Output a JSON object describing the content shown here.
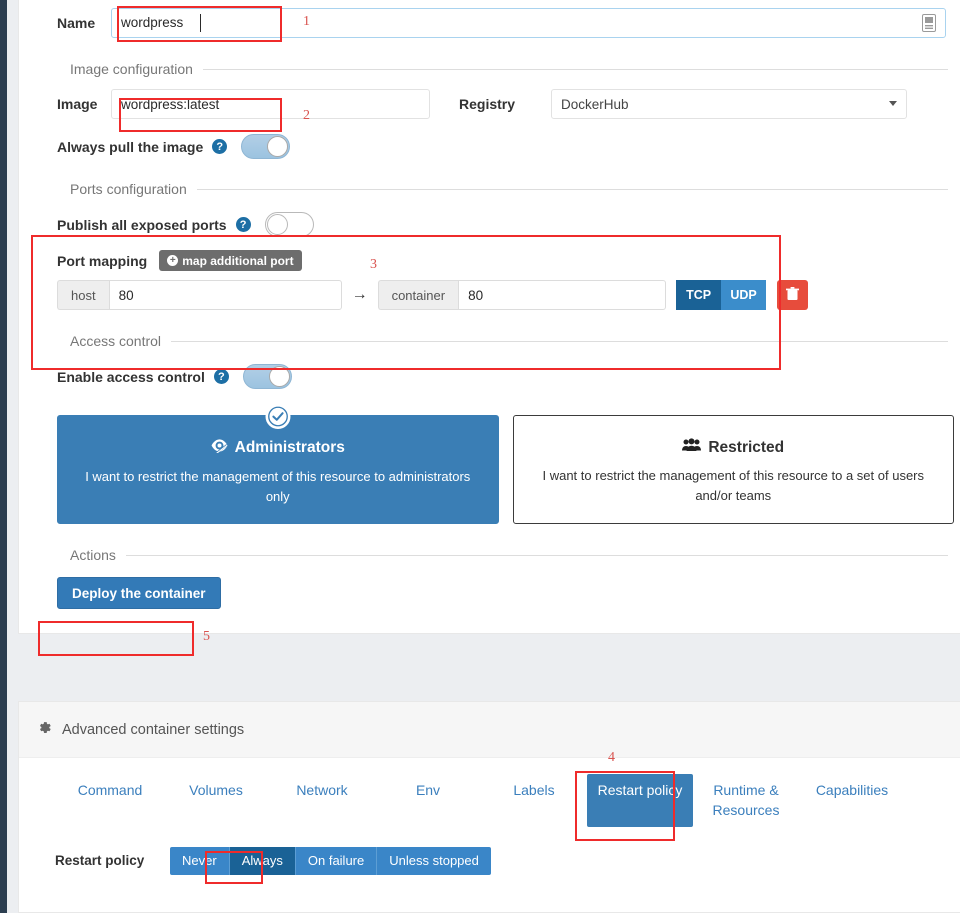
{
  "form": {
    "name": {
      "label": "Name",
      "value": "wordpress",
      "icon": "id-badge-icon"
    },
    "sections": {
      "image": "Image configuration",
      "ports": "Ports configuration",
      "access": "Access control",
      "actions": "Actions"
    },
    "image": {
      "label": "Image",
      "value": "wordpress:latest"
    },
    "registry": {
      "label": "Registry",
      "value": "DockerHub",
      "options": [
        "DockerHub"
      ]
    },
    "always_pull": {
      "label": "Always pull the image",
      "state": "on",
      "help": "?"
    },
    "publish_all": {
      "label": "Publish all exposed ports",
      "state": "off",
      "help": "?"
    },
    "port_mapping": {
      "label": "Port mapping",
      "add_button": "map additional port",
      "host_addon": "host",
      "host_value": "80",
      "arrow": "→",
      "container_addon": "container",
      "container_value": "80",
      "protocols": [
        "TCP",
        "UDP"
      ],
      "selected_protocol": "TCP",
      "delete_icon": "trash-icon"
    },
    "access_control": {
      "toggle_label": "Enable access control",
      "toggle_state": "on",
      "help": "?",
      "cards": [
        {
          "title": "Administrators",
          "icon": "user-secret-icon",
          "desc": "I want to restrict the management of this resource to administrators only",
          "selected": true
        },
        {
          "title": "Restricted",
          "icon": "users-icon",
          "desc": "I want to restrict the management of this resource to a set of users and/or teams",
          "selected": false
        }
      ]
    },
    "deploy_button": "Deploy the container"
  },
  "advanced": {
    "header": "Advanced container settings",
    "header_icon": "gear-icon",
    "tabs": [
      {
        "label": "Command",
        "active": false
      },
      {
        "label": "Volumes",
        "active": false
      },
      {
        "label": "Network",
        "active": false
      },
      {
        "label": "Env",
        "active": false
      },
      {
        "label": "Labels",
        "active": false
      },
      {
        "label": "Restart policy",
        "active": true
      },
      {
        "label": "Runtime & Resources",
        "active": false
      },
      {
        "label": "Capabilities",
        "active": false
      }
    ],
    "restart_policy": {
      "label": "Restart policy",
      "options": [
        "Never",
        "Always",
        "On failure",
        "Unless stopped"
      ],
      "selected": "Always"
    }
  },
  "annotations": {
    "color": "#d9534f",
    "numbers": [
      "1",
      "2",
      "3",
      "4",
      "5"
    ]
  }
}
